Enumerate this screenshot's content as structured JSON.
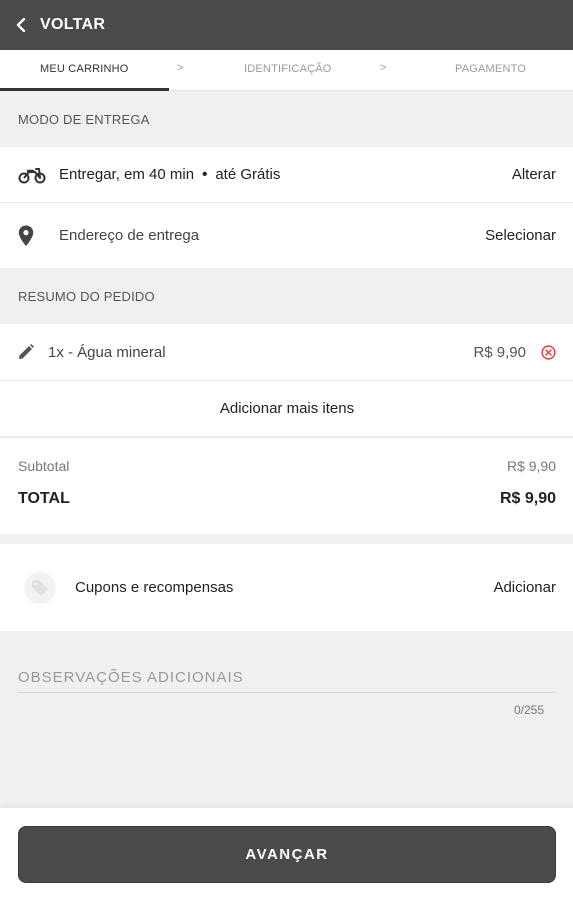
{
  "header": {
    "back_label": "VOLTAR"
  },
  "steps": {
    "items": [
      "MEU CARRINHO",
      "IDENTIFICAÇÃO",
      "PAGAMENTO"
    ],
    "separator": ">",
    "active_index": 0
  },
  "delivery": {
    "section_title": "MODO DE ENTREGA",
    "mode_text": "Entregar, em 40 min",
    "dot": "•",
    "cost_text": "até Grátis",
    "change_label": "Alterar",
    "address_placeholder": "Endereço de entrega",
    "select_label": "Selecionar"
  },
  "order": {
    "section_title": "RESUMO DO PEDIDO",
    "items": [
      {
        "label": "1x - Água mineral",
        "price": "R$ 9,90"
      }
    ],
    "add_more_label": "Adicionar mais itens"
  },
  "totals": {
    "subtotal_label": "Subtotal",
    "subtotal_value": "R$ 9,90",
    "total_label": "TOTAL",
    "total_value": "R$ 9,90"
  },
  "coupons": {
    "label": "Cupons e recompensas",
    "action_label": "Adicionar"
  },
  "notes": {
    "label": "OBSERVAÇÕES ADICIONAIS",
    "counter": "0/255"
  },
  "footer": {
    "advance_label": "AVANÇAR"
  },
  "colors": {
    "header_bg": "#4a4a4a",
    "remove_icon": "#e53935",
    "button_bg": "#4a4a4a"
  },
  "icons": {
    "back": "chevron-left-icon",
    "delivery": "motorcycle-icon",
    "address": "location-pin-icon",
    "edit": "pencil-icon",
    "remove": "close-circle-icon",
    "coupon": "tag-icon"
  }
}
